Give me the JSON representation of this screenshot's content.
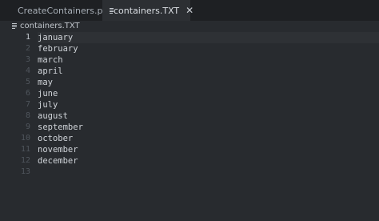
{
  "tabs": [
    {
      "label": "CreateContainers.py",
      "active": false
    },
    {
      "label": "containers.TXT",
      "active": true,
      "close_glyph": "✕"
    }
  ],
  "file_header": {
    "label": "containers.TXT",
    "icon": "document-icon"
  },
  "editor": {
    "current_line": 1,
    "line_numbers": [
      "1",
      "2",
      "3",
      "4",
      "5",
      "6",
      "7",
      "8",
      "9",
      "10",
      "11",
      "12",
      "13"
    ],
    "lines": [
      "january",
      "february",
      "march",
      "april",
      "may",
      "june",
      "july",
      "august",
      "september",
      "october",
      "november",
      "december",
      ""
    ]
  },
  "colors": {
    "background": "#282b2f",
    "tabbar": "#1e2023",
    "active_tab": "#2c2f33",
    "text": "#cfd3d8",
    "gutter_text": "#4f555c"
  }
}
